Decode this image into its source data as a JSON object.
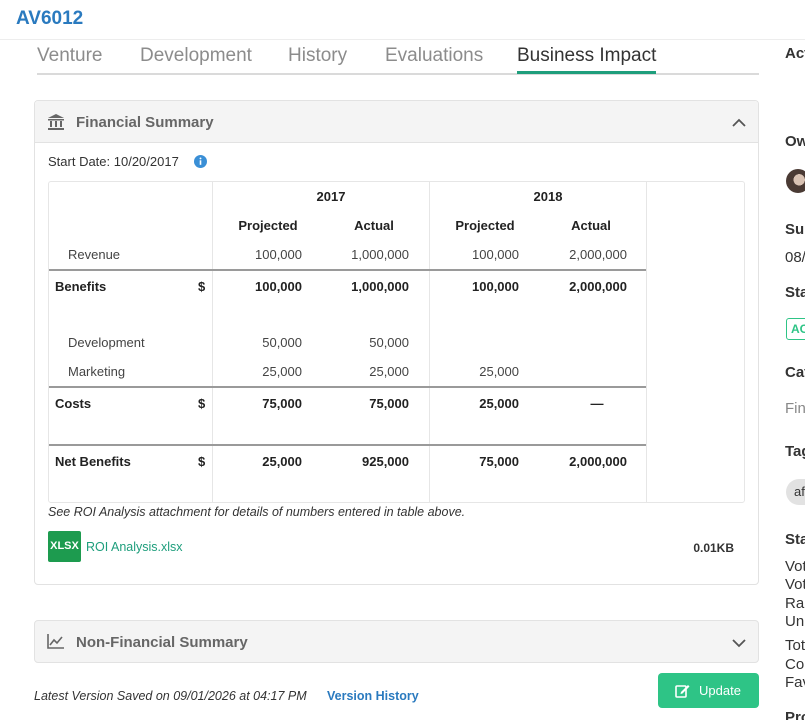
{
  "header": {
    "app_id": "AV6012"
  },
  "tabs": [
    {
      "label": "Venture",
      "active": false
    },
    {
      "label": "Development",
      "active": false
    },
    {
      "label": "History",
      "active": false
    },
    {
      "label": "Evaluations",
      "active": false
    },
    {
      "label": "Business Impact",
      "active": true
    }
  ],
  "financial_summary": {
    "title": "Financial Summary",
    "start_date": "Start Date: 10/20/2017",
    "years": [
      "2017",
      "2018"
    ],
    "sub_headers": [
      "Projected",
      "Actual",
      "Projected",
      "Actual"
    ],
    "currency": "$",
    "rows": {
      "revenue": {
        "label": "Revenue",
        "values": [
          "100,000",
          "1,000,000",
          "100,000",
          "2,000,000"
        ]
      },
      "benefits": {
        "label": "Benefits",
        "values": [
          "100,000",
          "1,000,000",
          "100,000",
          "2,000,000"
        ]
      },
      "development": {
        "label": "Development",
        "values": [
          "50,000",
          "50,000",
          "",
          ""
        ]
      },
      "marketing": {
        "label": "Marketing",
        "values": [
          "25,000",
          "25,000",
          "25,000",
          ""
        ]
      },
      "costs": {
        "label": "Costs",
        "values": [
          "75,000",
          "75,000",
          "25,000",
          "—"
        ]
      },
      "net_benefits": {
        "label": "Net Benefits",
        "values": [
          "25,000",
          "925,000",
          "75,000",
          "2,000,000"
        ]
      }
    },
    "footnote": "See ROI Analysis attachment for details of numbers entered in table above.",
    "attachment": {
      "badge": "XLSX",
      "name": "ROI Analysis.xlsx",
      "size": "0.01KB"
    }
  },
  "non_financial_summary": {
    "title": "Non-Financial Summary"
  },
  "footer": {
    "saved_text": "Latest Version Saved on 09/01/2026 at 04:17 PM",
    "version_history": "Version History",
    "update_label": "Update"
  },
  "sidebar": {
    "items": [
      {
        "text": "Act",
        "style": "head"
      },
      {
        "text": "Ow",
        "style": "head"
      },
      {
        "text": "Sub",
        "style": "head"
      },
      {
        "text": "08/",
        "style": "normal"
      },
      {
        "text": "Sta",
        "style": "head"
      },
      {
        "text": "AC",
        "style": "chip"
      },
      {
        "text": "Cat",
        "style": "head"
      },
      {
        "text": "Fin",
        "style": "muted"
      },
      {
        "text": "Tag",
        "style": "head"
      },
      {
        "text": "af",
        "style": "tag"
      },
      {
        "text": "Sta",
        "style": "head"
      },
      {
        "text": "Vot",
        "style": "normal"
      },
      {
        "text": "Vot",
        "style": "normal"
      },
      {
        "text": "Ran",
        "style": "normal"
      },
      {
        "text": "Uni",
        "style": "normal"
      },
      {
        "text": "Tot",
        "style": "normal"
      },
      {
        "text": "Cor",
        "style": "normal"
      },
      {
        "text": "Fav",
        "style": "normal"
      },
      {
        "text": "Pro",
        "style": "head"
      }
    ]
  },
  "colors": {
    "brand_blue": "#2a7abf",
    "accent_green": "#1e9e7c",
    "button_green": "#2ec486",
    "xlsx_green": "#1d9b4f"
  },
  "icons": {
    "financial": "bank-icon",
    "info": "info-icon",
    "collapse": "chevron-up-icon",
    "expand": "chevron-down-icon",
    "non_financial": "line-chart-icon",
    "update": "edit-icon"
  }
}
